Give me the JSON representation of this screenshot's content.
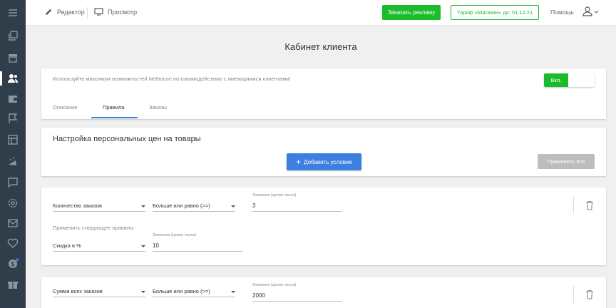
{
  "topbar": {
    "editor_label": "Редактор",
    "preview_label": "Просмотр",
    "order_ad_label": "Заказать рекламу",
    "tariff_label": "Тариф «Магазин» до: 01.12.21",
    "help_label": "Помощь"
  },
  "sidebar": {
    "items": [
      "copy-icon",
      "store-icon",
      "users-icon",
      "wallet-icon",
      "flag-icon",
      "layout-icon",
      "promo-icon",
      "chat-icon",
      "settings-icon",
      "mail-icon",
      "heart-icon",
      "badge-icon",
      "gift-icon"
    ],
    "active": "users-icon"
  },
  "page": {
    "title": "Кабинет клиента"
  },
  "promo": {
    "text": "Используйте максимум возможностей Nethouse по взаимодействию с имеющимися клиентами!",
    "toggle_label": "Вкл."
  },
  "tabs": [
    {
      "label": "Описание",
      "active": false
    },
    {
      "label": "Правила",
      "active": true
    },
    {
      "label": "Заказы",
      "active": false
    }
  ],
  "prices_section": {
    "title": "Настройка персональных цен на товары",
    "add_condition_label": "Добавить условие",
    "apply_all_label": "Применить всё"
  },
  "rules": [
    {
      "condition": "Количество заказов",
      "operator": "Больше или равно (>=)",
      "value_label": "Значение (целое число)",
      "value": "3",
      "apply_label": "Применить следующее правило:",
      "action": "Скидка в %",
      "action_value_label": "Значение (целое число)",
      "action_value": "10"
    },
    {
      "condition": "Сумма всех заказов",
      "operator": "Больше или равно (>=)",
      "value_label": "Значение (целое число)",
      "value": "2000"
    }
  ],
  "colors": {
    "sidebar_bg": "#2f3e4a",
    "accent_green": "#1bbc2c",
    "accent_blue": "#3d7fe0",
    "disabled_gray": "#bdbdbd"
  }
}
